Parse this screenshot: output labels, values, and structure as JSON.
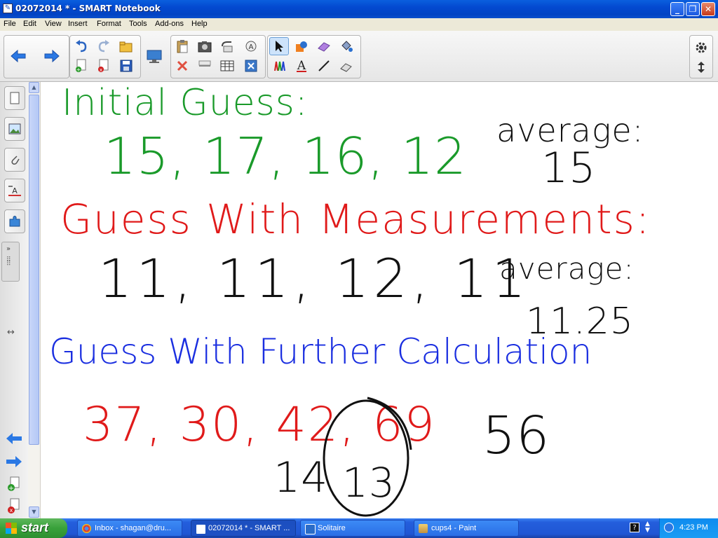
{
  "window": {
    "title": "02072014 * - SMART Notebook",
    "app_icon": "smart-notebook-icon"
  },
  "menu": [
    "File",
    "Edit",
    "View",
    "Insert",
    "Format",
    "Tools",
    "Add-ons",
    "Help"
  ],
  "toolbar": {
    "icons": [
      "back-arrow-icon",
      "forward-arrow-icon",
      "undo-icon",
      "redo-icon",
      "open-folder-icon",
      "new-page-icon",
      "delete-page-icon",
      "save-icon",
      "display-icon",
      "paste-icon",
      "screen-capture-icon",
      "clear-page-icon",
      "undo-redo-icon",
      "spell-check-icon",
      "delete-icon",
      "screen-shade-icon",
      "table-icon",
      "close-x-icon",
      "select-arrow-icon",
      "shapes-icon",
      "eraser-icon",
      "fill-icon",
      "pens-icon",
      "text-icon",
      "line-icon",
      "magic-eraser-icon",
      "settings-gear-icon",
      "move-toolbar-icon"
    ]
  },
  "sidebar": {
    "tabs": [
      "page-sorter-icon",
      "gallery-icon",
      "attachments-icon",
      "properties-icon",
      "add-ons-icon"
    ]
  },
  "page": {
    "heading1": "Initial Guess:",
    "row1": "15, 17, 16, 12",
    "avg1_label": "average:",
    "avg1_value": "15",
    "heading2": "Guess With Measurements:",
    "row2": "11, 11, 12, 11",
    "avg2_label": "average:",
    "avg2_value": "11.25",
    "heading3": "Guess With Further Calculation",
    "row3": "37, 30, 42, 69",
    "sub1": "14",
    "sub2": "13",
    "result": "56",
    "colors": {
      "green": "#1a9a2a",
      "red": "#e01a1a",
      "blue": "#1a2ee0",
      "black": "#111111"
    }
  },
  "taskbar": {
    "start_label": "start",
    "tasks": [
      {
        "label": "Inbox - shagan@dru...",
        "icon": "chrome-icon"
      },
      {
        "label": "02072014 * - SMART ...",
        "icon": "smart-notebook-icon"
      },
      {
        "label": "Solitaire",
        "icon": "solitaire-icon"
      },
      {
        "label": "cups4 - Paint",
        "icon": "paint-icon"
      }
    ],
    "clock": "4:23 PM"
  }
}
